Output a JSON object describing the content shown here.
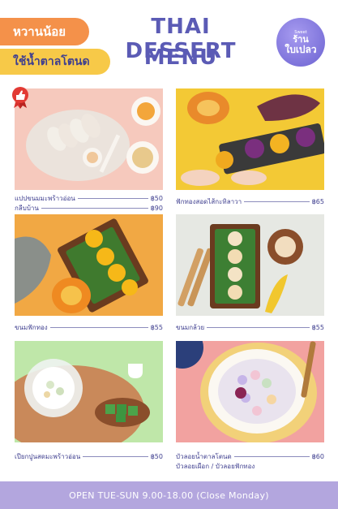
{
  "header": {
    "badge_orange": "หวานน้อย",
    "badge_yellow": "ใช้น้ำตาลโตนด",
    "title_line1": "THAI DESSERT",
    "title_line2": "MENU",
    "logo_top": "Sweet",
    "logo_line1": "ร้าน",
    "logo_line2": "ใบเปลว"
  },
  "items": [
    {
      "lines": [
        {
          "name": "แปปขนมมะพร้าวอ่อน",
          "price": "฿50"
        },
        {
          "name": "กลีบบ้าน",
          "price": "฿90"
        }
      ]
    },
    {
      "lines": [
        {
          "name": "ฟักทองสอดไส้กะทิลาวา",
          "price": "฿65"
        }
      ]
    },
    {
      "lines": [
        {
          "name": "ขนมฟักทอง",
          "price": "฿55"
        }
      ]
    },
    {
      "lines": [
        {
          "name": "ขนมกล้วย",
          "price": "฿55"
        }
      ]
    },
    {
      "lines": [
        {
          "name": "เปียกปูนสดมะพร้าวอ่อน",
          "price": "฿50"
        }
      ]
    },
    {
      "lines": [
        {
          "name": "บัวลอยน้ำตาลโตนด",
          "price": "฿60"
        },
        {
          "name": "บัวลอยเผือก / บัวลอยฟักทอง",
          "price": ""
        }
      ]
    }
  ],
  "footer": {
    "hours": "OPEN TUE-SUN 9.00-18.00 (Close Monday)"
  },
  "colors": {
    "accent": "#5b5bb5",
    "orange": "#f4914a",
    "yellow": "#f7c948",
    "footer": "#b3a6de"
  },
  "icons": {
    "recommend": "thumbs-up-ribbon-icon"
  }
}
